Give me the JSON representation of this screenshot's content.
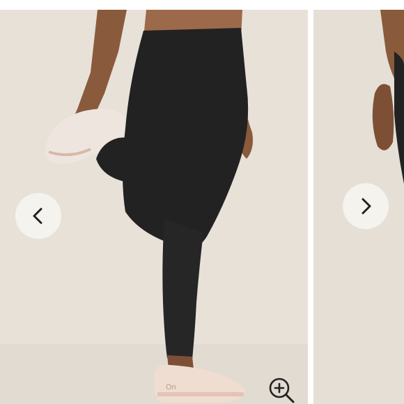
{
  "gallery": {
    "photos": [
      {
        "description_icon": "product-photo",
        "shoe_logo": "On"
      },
      {
        "description_icon": "product-photo"
      }
    ],
    "prev_button": {
      "icon": "chevron-left-icon"
    },
    "next_button": {
      "icon": "chevron-right-icon"
    },
    "zoom_button": {
      "icon": "zoom-in-icon"
    },
    "colors": {
      "background": "#e7e1d8",
      "leggings": "#222222",
      "skin": "#8a5a3c",
      "shoe": "#f0ddd2",
      "button_bg": "#f6f4f0",
      "icon": "#222222"
    }
  }
}
